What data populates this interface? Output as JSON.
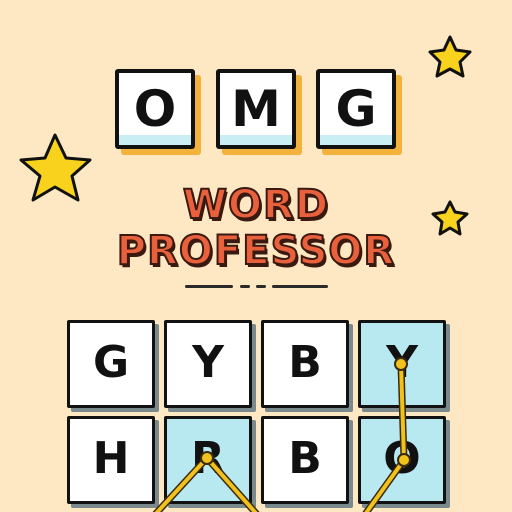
{
  "logo": {
    "letters": [
      "O",
      "M",
      "G"
    ],
    "title_line1": "WORD",
    "title_line2": "PROFESSOR"
  },
  "board": {
    "rows": [
      [
        "G",
        "Y",
        "B",
        "Y"
      ],
      [
        "H",
        "R",
        "B",
        "O"
      ]
    ],
    "selected": [
      [
        0,
        3
      ],
      [
        1,
        3
      ],
      [
        1,
        1
      ]
    ]
  },
  "colors": {
    "background": "#fde8c3",
    "title": "#e8603c",
    "star": "#f8d21c",
    "selected_tile": "#b8e8f0",
    "path": "#f2c21c"
  },
  "decorations": [
    "star-icon",
    "star-icon",
    "star-icon"
  ]
}
